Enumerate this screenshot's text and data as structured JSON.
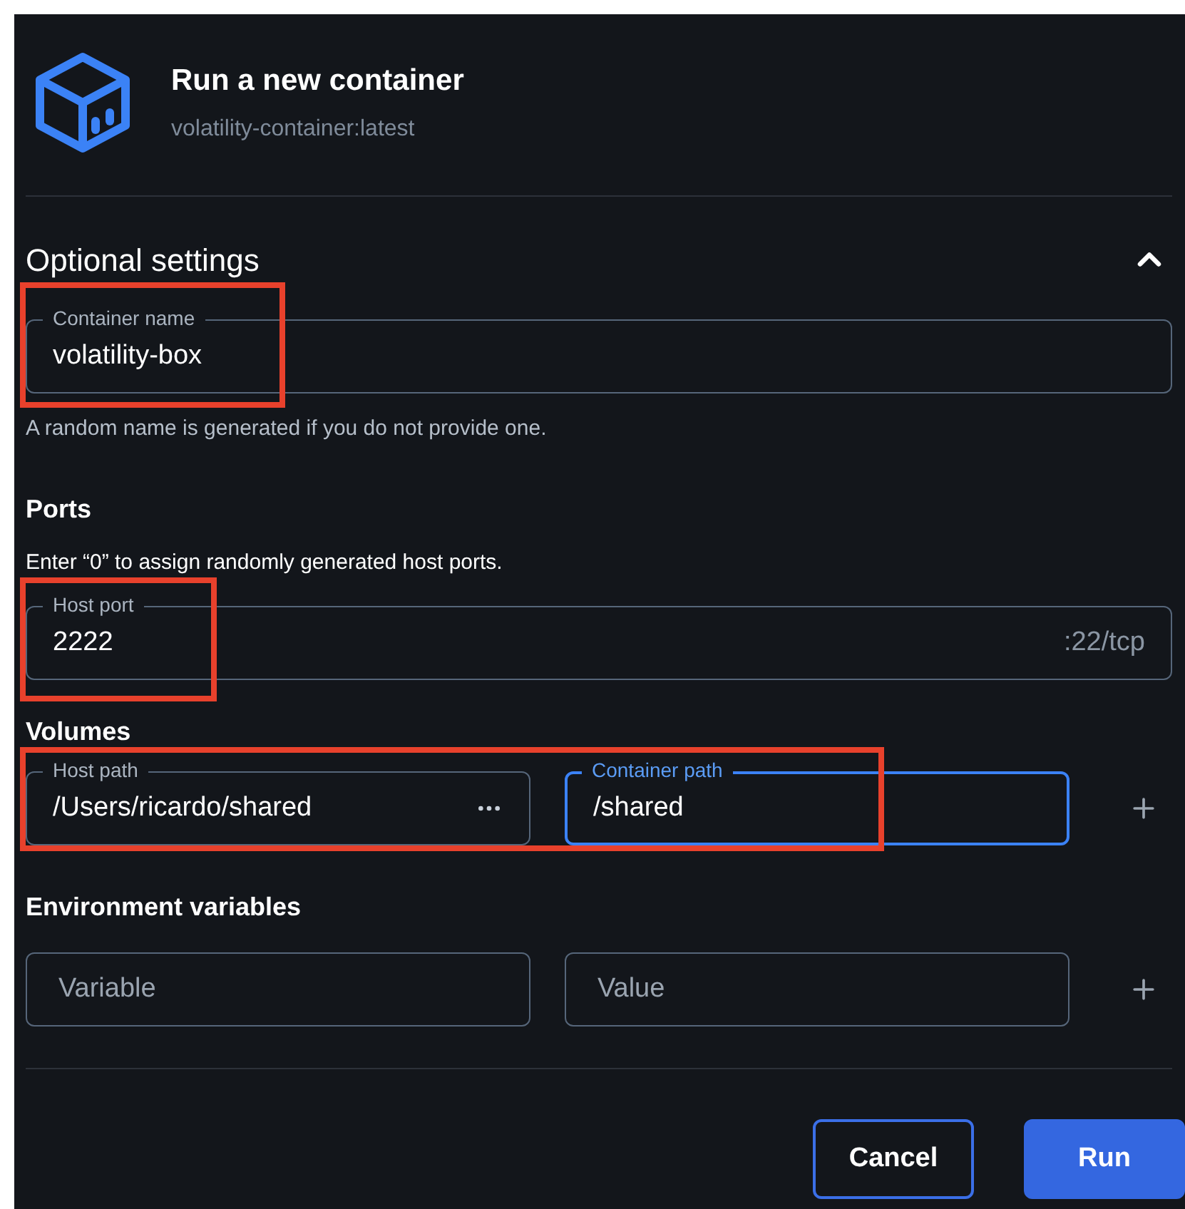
{
  "dialog": {
    "title": "Run a new container",
    "subtitle": "volatility-container:latest"
  },
  "optional_settings": {
    "heading": "Optional settings",
    "expanded": true
  },
  "container_name": {
    "label": "Container name",
    "value": "volatility-box",
    "focused": false,
    "highlighted": true,
    "helper": "A random name is generated if you do not provide one."
  },
  "ports": {
    "heading": "Ports",
    "hint": "Enter “0” to assign randomly generated host ports.",
    "fields": [
      {
        "label": "Host port",
        "value": "2222",
        "suffix": ":22/tcp",
        "focused": false,
        "highlighted": true
      }
    ]
  },
  "volumes": {
    "heading": "Volumes",
    "highlighted": true,
    "rows": [
      {
        "host_path": {
          "label": "Host path",
          "value": "/Users/ricardo/shared",
          "focused": false
        },
        "container_path": {
          "label": "Container path",
          "value": "/shared",
          "focused": true
        }
      }
    ]
  },
  "environment_variables": {
    "heading": "Environment variables",
    "rows": [
      {
        "variable": {
          "placeholder": "Variable",
          "focused": false
        },
        "value": {
          "placeholder": "Value",
          "focused": false
        }
      }
    ]
  },
  "buttons": [
    {
      "label": "Cancel",
      "kind": "secondary"
    },
    {
      "label": "Run",
      "kind": "primary"
    }
  ]
}
